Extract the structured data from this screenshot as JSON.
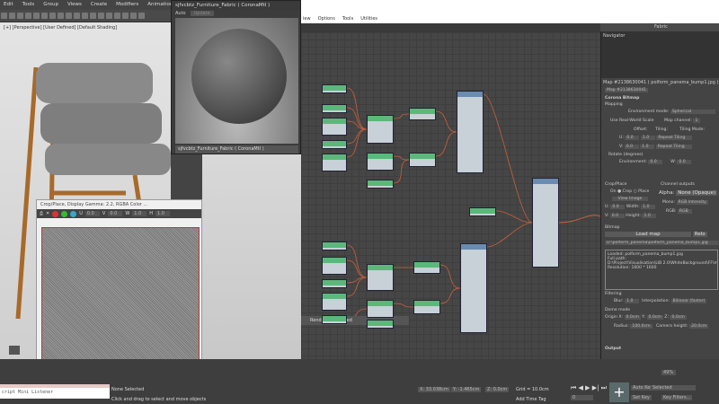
{
  "menubar": [
    "Edit",
    "Tools",
    "Group",
    "Views",
    "Create",
    "Modifiers",
    "Animation"
  ],
  "viewport": {
    "label": "[+] [Perspective] [User Defined] [Default Shading]"
  },
  "material_preview": {
    "title": "sjfvcbtz_Furniture_Fabric ( CoronaMtl )",
    "auto": "Auto",
    "update": "Update",
    "selector": "sjfvcbtz_Furniture_Fabric ( CoronaMtl )"
  },
  "slate": {
    "menu": [
      "iew",
      "Options",
      "Tools",
      "Utilities"
    ],
    "tab": "Fabric",
    "navigator": "Navigator",
    "rendering": "Rendering finished"
  },
  "crop_window": {
    "title": "Crop/Place, Display Gamma: 2.2, RGBA Color ...",
    "u": "0.0",
    "v": "0.0",
    "w": "1.0",
    "h": "1.0"
  },
  "panel": {
    "title": "Map #2138630041 ( polform_panema_bump1.jpg )",
    "subtitle": "Map #2138630041",
    "section": "Corona Bitmap",
    "mapping": "Mapping",
    "env_mode_label": "Environment mode:",
    "env_mode": "Spherical",
    "real_world": "Use Real-World Scale",
    "map_channel_label": "Map channel:",
    "map_channel": "1",
    "offset": "Offset:",
    "tiling": "Tiling:",
    "tiling_mode": "Tiling Mode:",
    "u_label": "U:",
    "v_label": "V:",
    "u_off": "0.0",
    "v_off": "0.0",
    "u_tile": "1.0",
    "v_tile": "1.0",
    "repeat": "Repeat Tiling",
    "rotate": "Rotate (degrees)",
    "env_label": "Environment:",
    "env_val": "0.0",
    "w_label": "W:",
    "w_val": "0.0",
    "crop": "Crop/Place",
    "on": "On",
    "crop_opt": "Crop",
    "place": "Place",
    "view_image": "View Image",
    "cu": "0.0",
    "cv": "0.0",
    "width_label": "Width:",
    "width": "1.0",
    "height_label": "Height:",
    "height": "1.0",
    "channel": "Channel outputs",
    "alpha_label": "Alpha:",
    "alpha": "None (Opaque)",
    "mono_label": "Mono:",
    "mono": "RGB Intensity",
    "rgb_label": "RGB:",
    "rgb": "RGB",
    "bitmap": "Bitmap",
    "load": "Load map",
    "reload": "Relo",
    "path": "D:\\polform_panema\\polform_panema_bump1.jpg",
    "info": [
      "Loaded: polform_panema_bump1.jpg",
      "Full path:",
      "D:\\Project\\Visualisation\\LIB 2.0\\WhiteBackground\\FF\\mapa",
      "Resolution: 1600 * 1600"
    ],
    "filtering": "Filtering",
    "blur_label": "Blur:",
    "blur": "1.0",
    "interp_label": "Interpolation:",
    "interp": "Bilinear (faster)",
    "dome": "Dome mode",
    "origin": "Origin X:",
    "y": "Y:",
    "z": "Z:",
    "radius": "Radius:",
    "camera": "Camera height:",
    "origin_val": "0.0cm",
    "radius_val": "100.0cm",
    "camera_val": "20.0cm",
    "output": "Output"
  },
  "status": {
    "selected": "None Selected",
    "hint": "Click and drag to select and move objects",
    "maxscript": "cript Mini Listener",
    "x": "X: 33.038cm",
    "yv": "Y: -1.465cm",
    "z": "Z: 0.0cm",
    "grid": "Grid = 10.0cm",
    "tag": "Add Time Tag",
    "autokey": "Auto Key",
    "setkey": "Set Key",
    "selected_dd": "Selected",
    "keyfilters": "Key Filters...",
    "frame": "0",
    "zoom": "49%"
  }
}
